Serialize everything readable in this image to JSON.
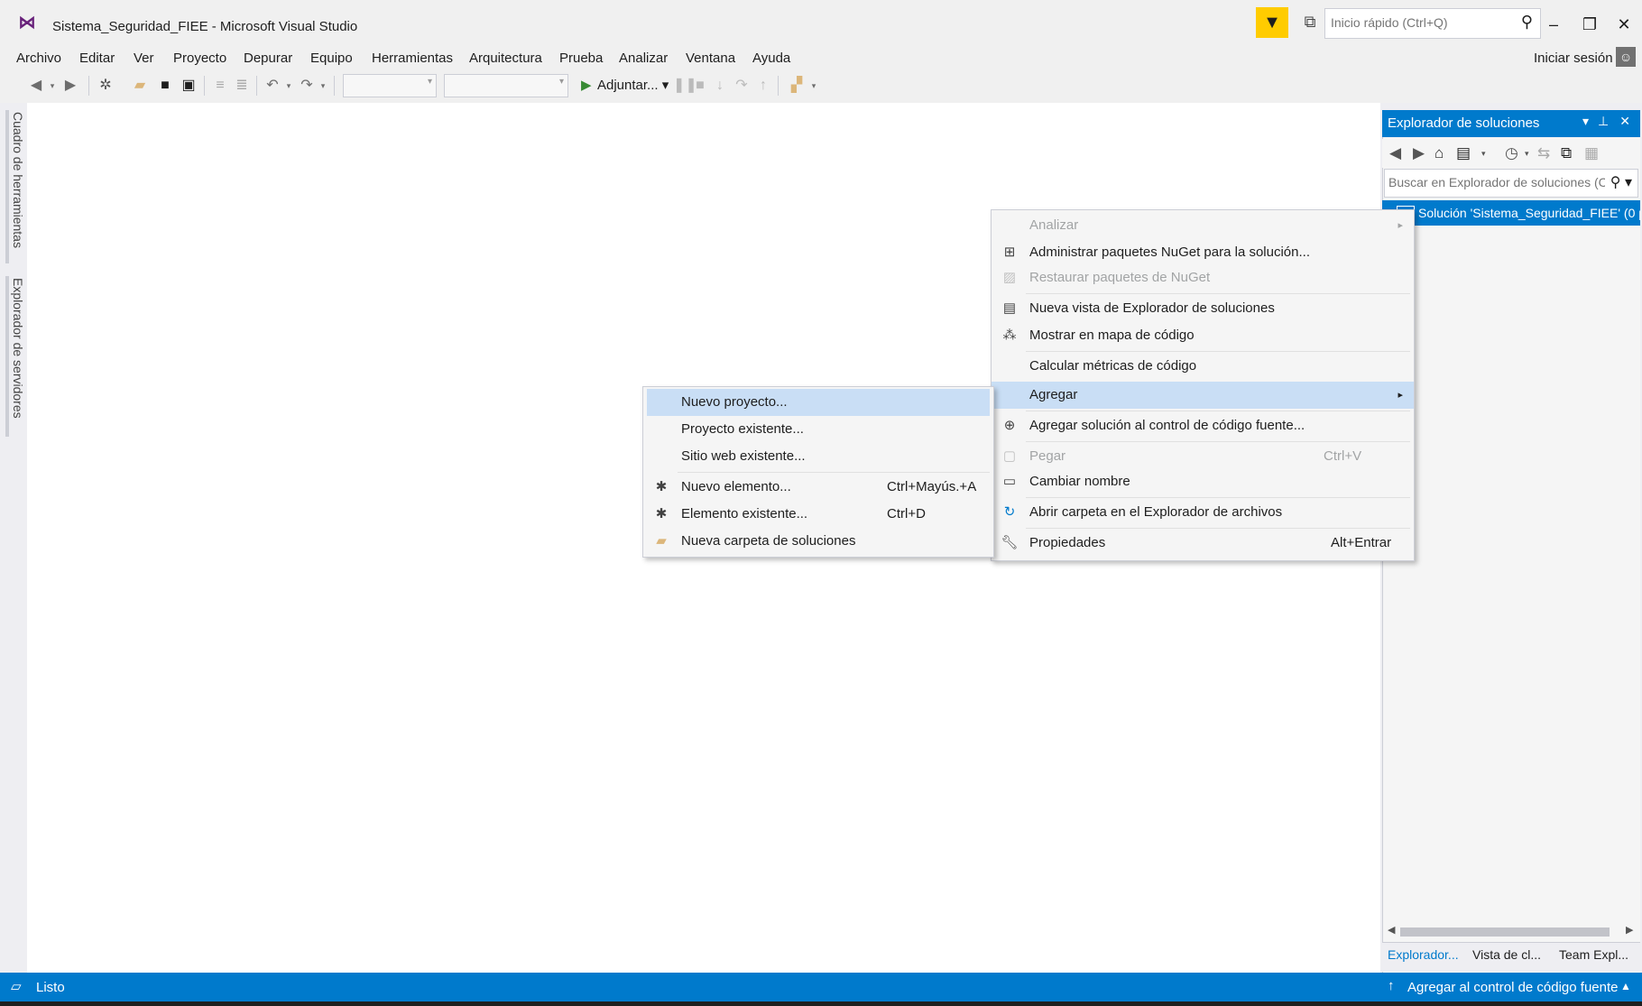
{
  "window": {
    "title": "Sistema_Seguridad_FIEE - Microsoft Visual Studio",
    "quick_launch_placeholder": "Inicio rápido (Ctrl+Q)",
    "sign_in": "Iniciar sesión"
  },
  "menubar": [
    "Archivo",
    "Editar",
    "Ver",
    "Proyecto",
    "Depurar",
    "Equipo",
    "Herramientas",
    "Arquitectura",
    "Prueba",
    "Analizar",
    "Ventana",
    "Ayuda"
  ],
  "toolbar": {
    "run_label": "Adjuntar... ▾"
  },
  "side_tabs": [
    "Cuadro de herramientas",
    "Explorador de servidores"
  ],
  "solution_explorer": {
    "title": "Explorador de soluciones",
    "search_placeholder": "Buscar en Explorador de soluciones (C",
    "item": "Solución 'Sistema_Seguridad_FIEE' (0 p",
    "tabs": [
      "Explorador...",
      "Vista de cl...",
      "Team Expl..."
    ]
  },
  "context_menu": [
    {
      "label": "Analizar",
      "icon": "none",
      "disabled": true,
      "submenu": true
    },
    {
      "label": "Administrar paquetes NuGet para la solución...",
      "icon": "nuget-icon"
    },
    {
      "label": "Restaurar paquetes de NuGet",
      "icon": "restore-icon",
      "disabled": true
    },
    {
      "label": "Nueva vista de Explorador de soluciones",
      "icon": "new-view-icon"
    },
    {
      "label": "Mostrar en mapa de código",
      "icon": "code-map-icon"
    },
    {
      "label": "Calcular métricas de código",
      "icon": "none"
    },
    {
      "label": "Agregar",
      "icon": "none",
      "submenu": true,
      "highlight": true
    },
    {
      "label": "Agregar solución al control de código fuente...",
      "icon": "source-control-icon"
    },
    {
      "label": "Pegar",
      "icon": "paste-icon",
      "disabled": true,
      "shortcut": "Ctrl+V"
    },
    {
      "label": "Cambiar nombre",
      "icon": "rename-icon"
    },
    {
      "label": "Abrir carpeta en el Explorador de archivos",
      "icon": "open-folder-icon"
    },
    {
      "label": "Propiedades",
      "icon": "wrench-icon",
      "shortcut": "Alt+Entrar"
    }
  ],
  "submenu": [
    {
      "label": "Nuevo proyecto...",
      "icon": "none",
      "highlight": true
    },
    {
      "label": "Proyecto existente...",
      "icon": "none"
    },
    {
      "label": "Sitio web existente...",
      "icon": "none"
    },
    {
      "label": "Nuevo elemento...",
      "icon": "new-item-icon",
      "shortcut": "Ctrl+Mayús.+A"
    },
    {
      "label": "Elemento existente...",
      "icon": "existing-item-icon",
      "shortcut": "Ctrl+D"
    },
    {
      "label": "Nueva carpeta de soluciones",
      "icon": "folder-icon"
    }
  ],
  "statusbar": {
    "text": "Listo",
    "source_control": "Agregar al control de código fuente"
  },
  "colors": {
    "accent": "#007acc",
    "highlight": "#c9def5",
    "filter": "#ffcc00"
  }
}
